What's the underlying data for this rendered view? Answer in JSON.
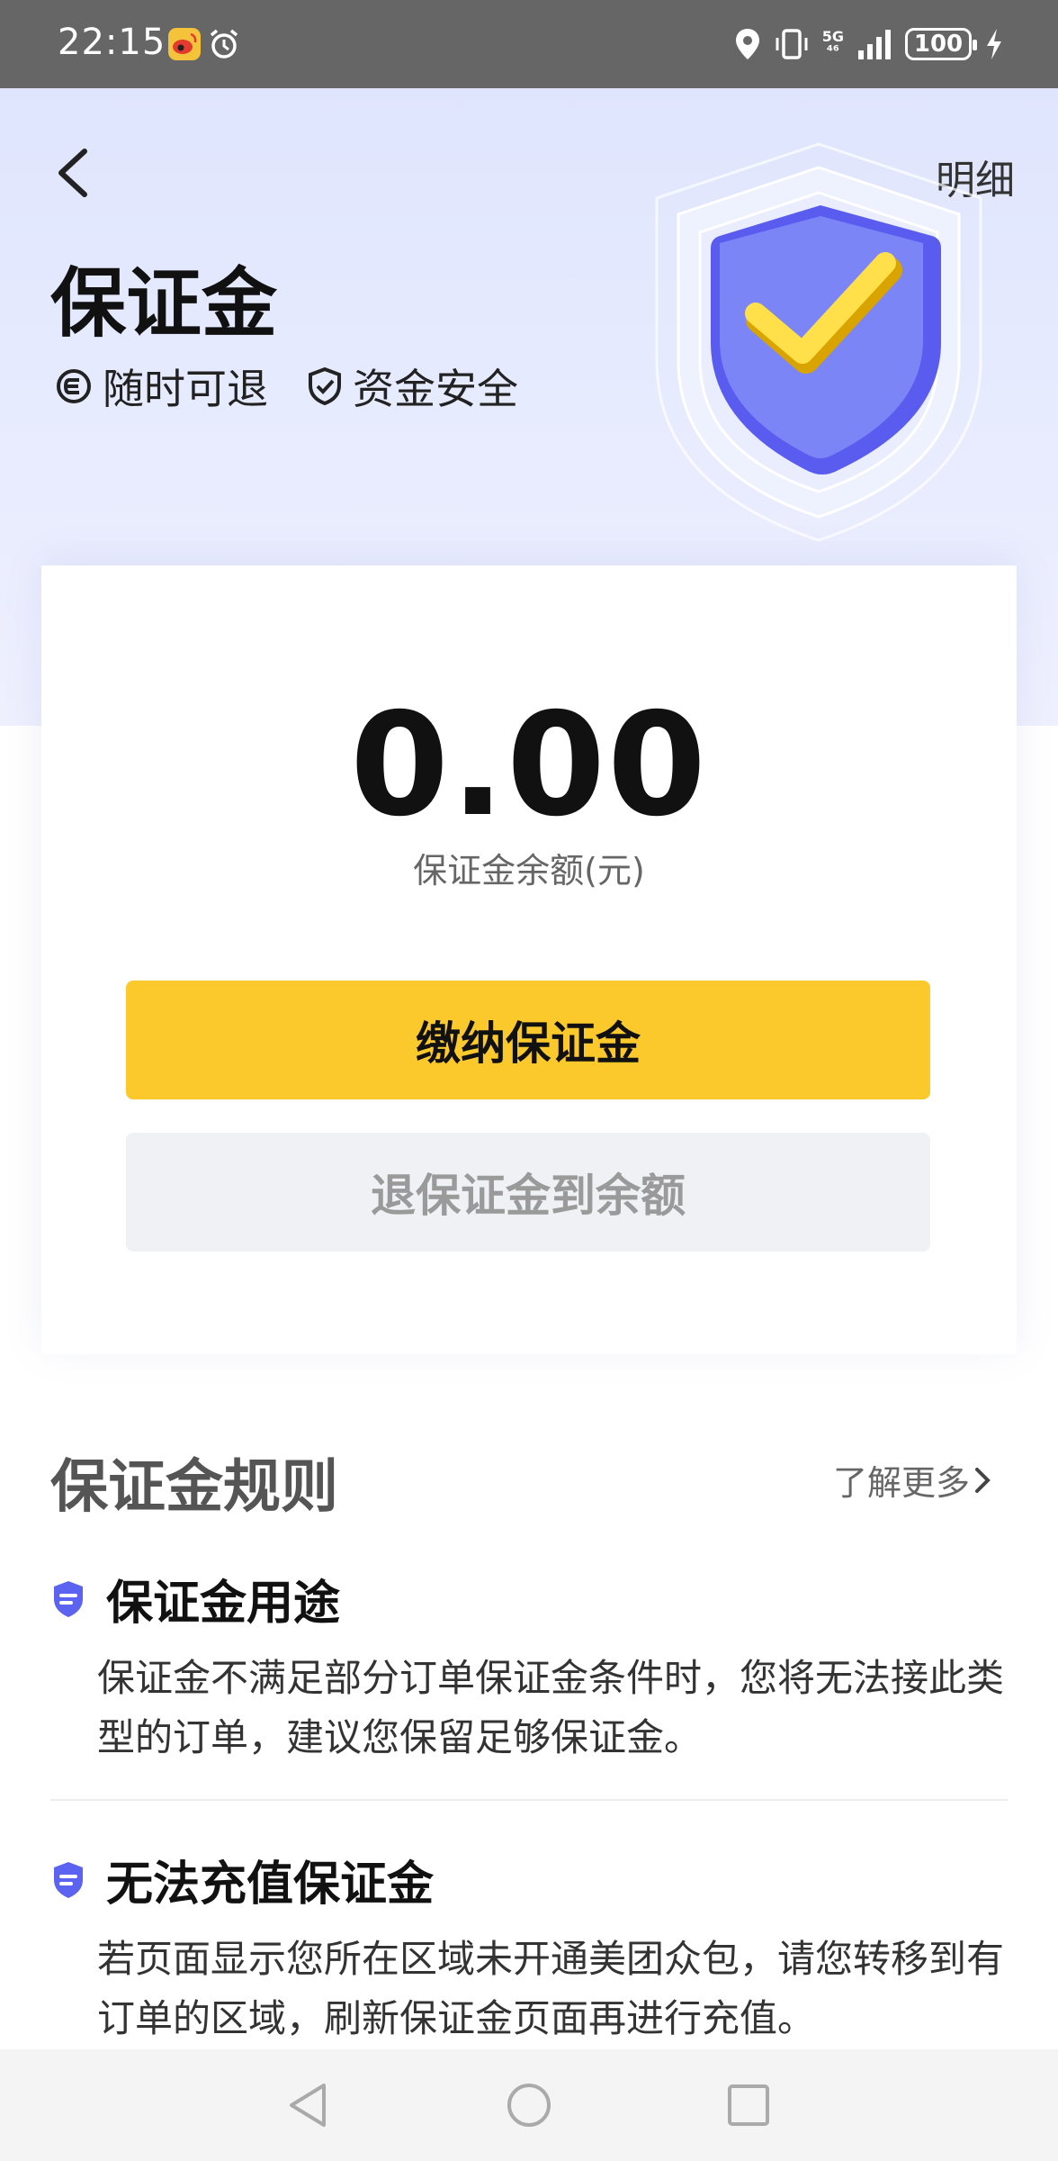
{
  "status_bar": {
    "time": "22:15",
    "network": "5G",
    "battery": "100",
    "icons": [
      "weibo-icon",
      "alarm-icon",
      "location-icon",
      "vibrate-icon",
      "signal-icon",
      "charging-icon"
    ]
  },
  "header": {
    "detail_link": "明细",
    "title": "保证金",
    "features": [
      {
        "icon": "refund-icon",
        "label": "随时可退"
      },
      {
        "icon": "shield-check-icon",
        "label": "资金安全"
      }
    ]
  },
  "balance": {
    "amount": "0.00",
    "label": "保证金余额(元)"
  },
  "buttons": {
    "pay": "缴纳保证金",
    "refund": "退保证金到余额"
  },
  "rules": {
    "title": "保证金规则",
    "learn_more": "了解更多",
    "items": [
      {
        "title": "保证金用途",
        "body": "保证金不满足部分订单保证金条件时，您将无法接此类型的订单，建议您保留足够保证金。"
      },
      {
        "title": "无法充值保证金",
        "body": "若页面显示您所在区域未开通美团众包，请您转移到有订单的区域，刷新保证金页面再进行充值。"
      }
    ]
  },
  "colors": {
    "accent_yellow": "#fcc92d",
    "shield_blue": "#6b6ef5",
    "header_bg": "#e3e8fd"
  }
}
